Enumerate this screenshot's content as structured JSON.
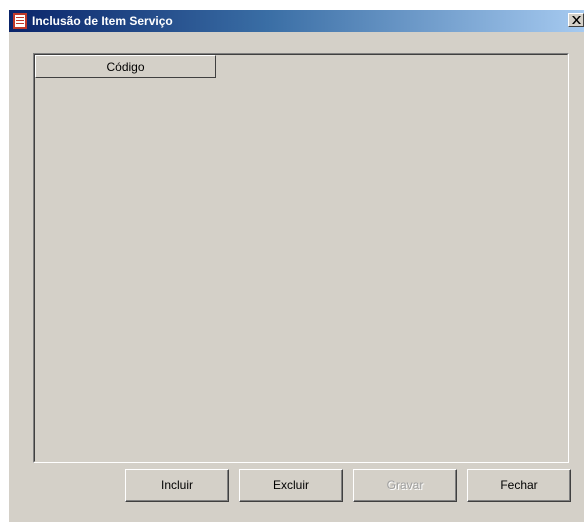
{
  "window": {
    "title": "Inclusão de Item Serviço",
    "icon": "document-icon",
    "close_label": "close-icon"
  },
  "grid": {
    "columns": [
      "Código"
    ],
    "rows": []
  },
  "buttons": {
    "incluir": "Incluir",
    "excluir": "Excluir",
    "gravar": "Gravar",
    "fechar": "Fechar"
  },
  "colors": {
    "title_gradient_start": "#0a246a",
    "title_gradient_end": "#a6caf0",
    "window_face": "#d4d0c8",
    "disabled_text": "#a0a0a0"
  }
}
